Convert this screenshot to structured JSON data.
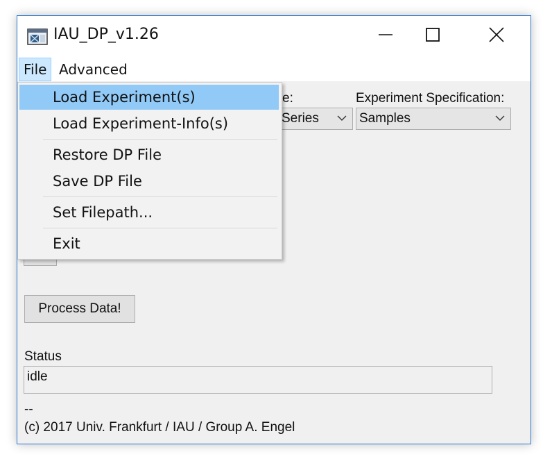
{
  "window": {
    "title": "IAU_DP_v1.26",
    "icon": "app-window-icon"
  },
  "menubar": {
    "file": "File",
    "advanced": "Advanced"
  },
  "file_menu": {
    "items": [
      {
        "label": "Load Experiment(s)",
        "highlighted": true
      },
      {
        "label": "Load Experiment-Info(s)"
      },
      {
        "label": "Restore DP File"
      },
      {
        "label": "Save DP File"
      },
      {
        "label": "Set Filepath..."
      },
      {
        "label": "Exit"
      }
    ]
  },
  "form": {
    "type_label_partial": "e:",
    "type_value_partial": "Series",
    "spec_label": "Experiment Specification:",
    "spec_value": "Samples",
    "process_button": "Process Data!",
    "status_label": "Status",
    "status_value": "idle",
    "footer_dash": "--",
    "copyright": "(c) 2017 Univ. Frankfurt / IAU / Group A. Engel"
  },
  "colors": {
    "highlight": "#91c9f7",
    "menu_file_active": "#cce8ff",
    "window_border": "#2b79d0"
  }
}
